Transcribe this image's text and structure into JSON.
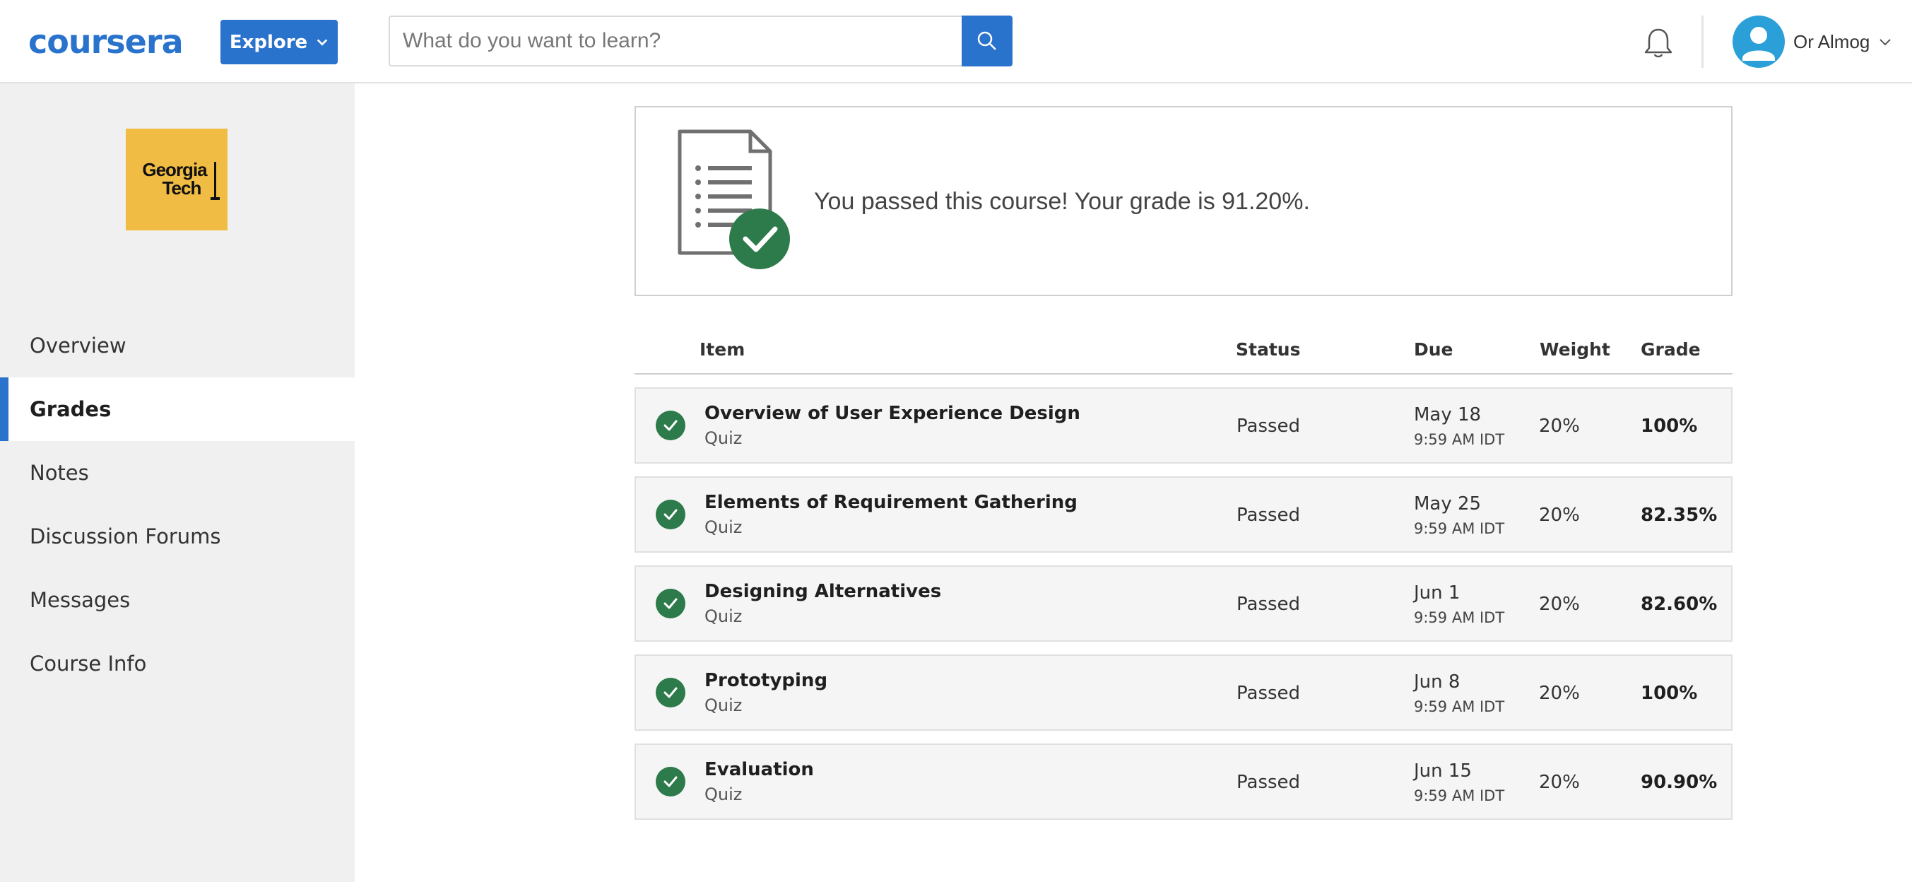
{
  "header": {
    "logo_text": "coursera",
    "explore_label": "Explore",
    "search_placeholder": "What do you want to learn?",
    "search_value": "",
    "user_name": "Or Almog"
  },
  "sidebar": {
    "school_logo_text": "Georgia Tech",
    "items": [
      {
        "label": "Overview",
        "active": false
      },
      {
        "label": "Grades",
        "active": true
      },
      {
        "label": "Notes",
        "active": false
      },
      {
        "label": "Discussion Forums",
        "active": false
      },
      {
        "label": "Messages",
        "active": false
      },
      {
        "label": "Course Info",
        "active": false
      }
    ]
  },
  "banner": {
    "text": "You passed this course! Your grade is 91.20%."
  },
  "grades_table": {
    "headers": {
      "item": "Item",
      "status": "Status",
      "due": "Due",
      "weight": "Weight",
      "grade": "Grade"
    },
    "rows": [
      {
        "title": "Overview of User Experience Design",
        "type": "Quiz",
        "status": "Passed",
        "due_date": "May 18",
        "due_time": "9:59 AM IDT",
        "weight": "20%",
        "grade": "100%"
      },
      {
        "title": "Elements of Requirement Gathering",
        "type": "Quiz",
        "status": "Passed",
        "due_date": "May 25",
        "due_time": "9:59 AM IDT",
        "weight": "20%",
        "grade": "82.35%"
      },
      {
        "title": "Designing Alternatives",
        "type": "Quiz",
        "status": "Passed",
        "due_date": "Jun 1",
        "due_time": "9:59 AM IDT",
        "weight": "20%",
        "grade": "82.60%"
      },
      {
        "title": "Prototyping",
        "type": "Quiz",
        "status": "Passed",
        "due_date": "Jun 8",
        "due_time": "9:59 AM IDT",
        "weight": "20%",
        "grade": "100%"
      },
      {
        "title": "Evaluation",
        "type": "Quiz",
        "status": "Passed",
        "due_date": "Jun 15",
        "due_time": "9:59 AM IDT",
        "weight": "20%",
        "grade": "90.90%"
      }
    ]
  },
  "colors": {
    "brand_blue": "#2a73cc",
    "passed_green": "#2d7a4b",
    "sidebar_bg": "#f0f0f0",
    "school_gold": "#f0bc43"
  }
}
